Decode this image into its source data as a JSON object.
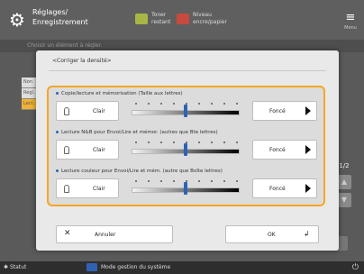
{
  "topbar": {
    "title": "Réglages/ Enregistrement",
    "indicator1": "Toner restant",
    "indicator2": "Niveau encre/papier",
    "menu_label": "Menu"
  },
  "background": {
    "subheader": "Choisir un élément à régler.",
    "list_items": [
      "Non",
      "Régl.",
      "Lect."
    ],
    "page_counter": "1/2",
    "scroll_up": "▲",
    "scroll_down": "▼"
  },
  "modal": {
    "title": "<Corriger la densité>",
    "sections": [
      {
        "label": "Copie/lecture et mémorisation (Taille aux lettres)",
        "light": "Clair",
        "dark": "Foncé",
        "level": 0.5
      },
      {
        "label": "Lecture N&B pour Envoi/Lire et mémor. (autres que Bte lettres)",
        "light": "Clair",
        "dark": "Foncé",
        "level": 0.5
      },
      {
        "label": "Lecture couleur pour Envoi/Lire et mém. (autre que Boîte lettres)",
        "light": "Clair",
        "dark": "Foncé",
        "level": 0.5
      }
    ],
    "cancel": "Annuler",
    "ok": "OK"
  },
  "bottombar": {
    "status": "Statut",
    "device_mode": "Mode gestion du système"
  },
  "colors": {
    "highlight": "#f5a623",
    "accent": "#2f62b4"
  }
}
